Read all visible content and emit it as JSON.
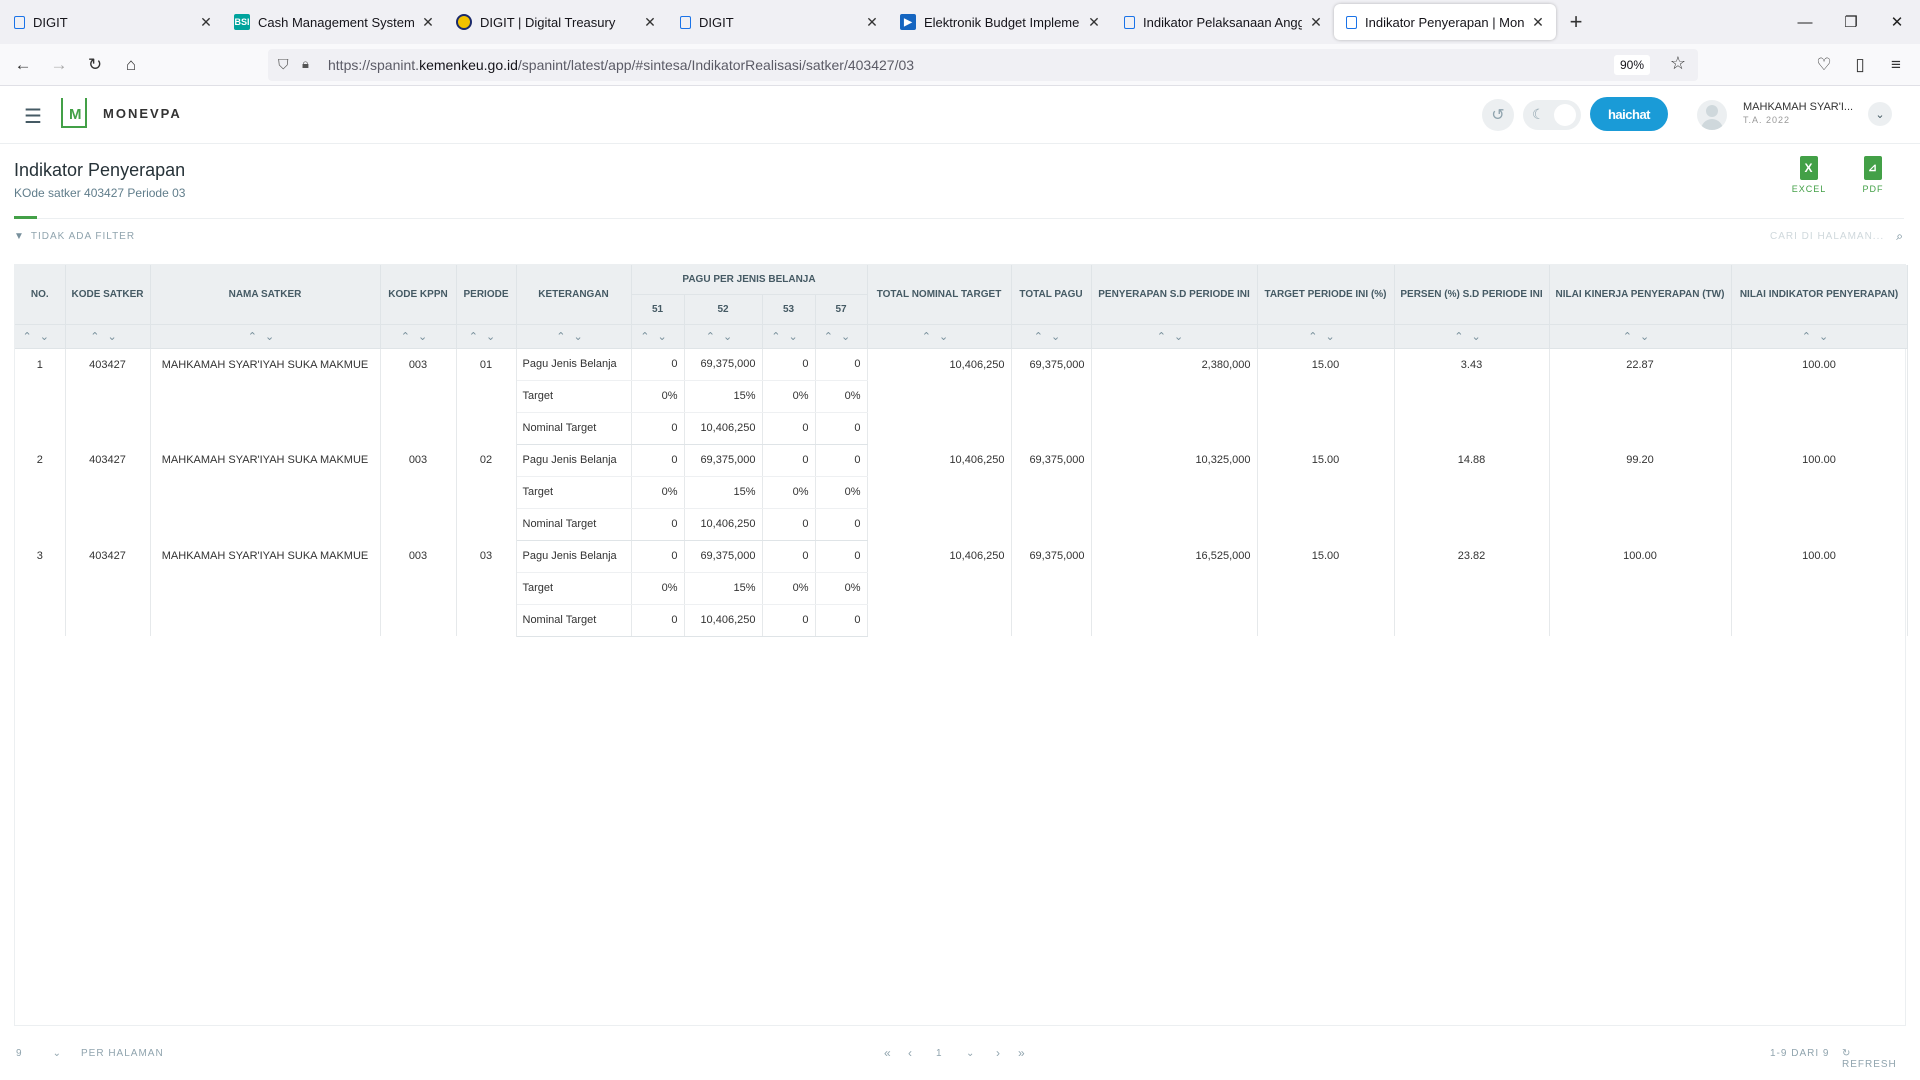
{
  "browser": {
    "tabs": [
      {
        "title": "DIGIT",
        "icon": "page-icon"
      },
      {
        "title": "Cash Management System - Ba",
        "icon": "bsi-icon"
      },
      {
        "title": "DIGIT | Digital Treasury",
        "icon": "kemenkeu-icon"
      },
      {
        "title": "DIGIT",
        "icon": "page-icon"
      },
      {
        "title": "Elektronik Budget Implementati",
        "icon": "play-icon"
      },
      {
        "title": "Indikator Pelaksanaan Anggarar",
        "icon": "page-icon"
      },
      {
        "title": "Indikator Penyerapan | MonevPA",
        "icon": "page-icon"
      }
    ],
    "url_prefix": "https://spanint.",
    "url_domain": "kemenkeu.go.id",
    "url_path": "/spanint/latest/app/#sintesa/IndikatorRealisasi/satker/403427/03",
    "zoom": "90%"
  },
  "app": {
    "brand": "MONEVPA",
    "logo_letter": "M",
    "haichat": "haichat",
    "user_name": "MAHKAMAH SYAR'I...",
    "user_year": "T.A. 2022"
  },
  "page": {
    "title": "Indikator Penyerapan",
    "subtitle": "KOde satker 403427 Periode 03",
    "excel": "EXCEL",
    "pdf": "PDF",
    "filter": "TIDAK ADA FILTER",
    "search_placeholder": "CARI DI HALAMAN..."
  },
  "table": {
    "headers": {
      "no": "NO.",
      "kode_satker": "KODE SATKER",
      "nama_satker": "NAMA SATKER",
      "kode_kppn": "KODE KPPN",
      "periode": "PERIODE",
      "keterangan": "KETERANGAN",
      "pagu_group": "PAGU PER JENIS BELANJA",
      "b51": "51",
      "b52": "52",
      "b53": "53",
      "b57": "57",
      "total_nominal_target": "TOTAL NOMINAL TARGET",
      "total_pagu": "TOTAL PAGU",
      "penyerapan": "PENYERAPAN S.D PERIODE INI",
      "target_periode": "TARGET PERIODE INI (%)",
      "persen": "PERSEN (%) S.D PERIODE INI",
      "nilai_kinerja": "NILAI KINERJA PENYERAPAN (TW)",
      "nilai_indikator": "NILAI INDIKATOR PENYERAPAN)"
    },
    "rows": [
      {
        "no": "1",
        "kode_satker": "403427",
        "nama_satker": "MAHKAMAH SYAR'IYAH SUKA MAKMUE",
        "kode_kppn": "003",
        "periode": "01",
        "lines": [
          {
            "ket": "Pagu Jenis Belanja",
            "b51": "0",
            "b52": "69,375,000",
            "b53": "0",
            "b57": "0"
          },
          {
            "ket": "Target",
            "b51": "0%",
            "b52": "15%",
            "b53": "0%",
            "b57": "0%"
          },
          {
            "ket": "Nominal Target",
            "b51": "0",
            "b52": "10,406,250",
            "b53": "0",
            "b57": "0"
          }
        ],
        "total_nominal_target": "10,406,250",
        "total_pagu": "69,375,000",
        "penyerapan": "2,380,000",
        "target_periode": "15.00",
        "persen": "3.43",
        "nilai_kinerja": "22.87",
        "nilai_indikator": "100.00"
      },
      {
        "no": "2",
        "kode_satker": "403427",
        "nama_satker": "MAHKAMAH SYAR'IYAH SUKA MAKMUE",
        "kode_kppn": "003",
        "periode": "02",
        "lines": [
          {
            "ket": "Pagu Jenis Belanja",
            "b51": "0",
            "b52": "69,375,000",
            "b53": "0",
            "b57": "0"
          },
          {
            "ket": "Target",
            "b51": "0%",
            "b52": "15%",
            "b53": "0%",
            "b57": "0%"
          },
          {
            "ket": "Nominal Target",
            "b51": "0",
            "b52": "10,406,250",
            "b53": "0",
            "b57": "0"
          }
        ],
        "total_nominal_target": "10,406,250",
        "total_pagu": "69,375,000",
        "penyerapan": "10,325,000",
        "target_periode": "15.00",
        "persen": "14.88",
        "nilai_kinerja": "99.20",
        "nilai_indikator": "100.00"
      },
      {
        "no": "3",
        "kode_satker": "403427",
        "nama_satker": "MAHKAMAH SYAR'IYAH SUKA MAKMUE",
        "kode_kppn": "003",
        "periode": "03",
        "lines": [
          {
            "ket": "Pagu Jenis Belanja",
            "b51": "0",
            "b52": "69,375,000",
            "b53": "0",
            "b57": "0"
          },
          {
            "ket": "Target",
            "b51": "0%",
            "b52": "15%",
            "b53": "0%",
            "b57": "0%"
          },
          {
            "ket": "Nominal Target",
            "b51": "0",
            "b52": "10,406,250",
            "b53": "0",
            "b57": "0"
          }
        ],
        "total_nominal_target": "10,406,250",
        "total_pagu": "69,375,000",
        "penyerapan": "16,525,000",
        "target_periode": "15.00",
        "persen": "23.82",
        "nilai_kinerja": "100.00",
        "nilai_indikator": "100.00"
      }
    ]
  },
  "footer": {
    "per_page_value": "9",
    "per_page_label": "PER HALAMAN",
    "page_number": "1",
    "range": "1-9 DARI 9",
    "refresh": "REFRESH"
  }
}
